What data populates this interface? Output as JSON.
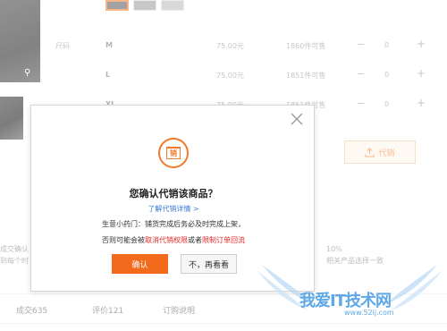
{
  "background": {
    "sizes": [
      {
        "label": "尺码",
        "size": "M",
        "price": "75.00元",
        "stock": "1860件可售",
        "qty": "0"
      },
      {
        "label": "",
        "size": "L",
        "price": "75.00元",
        "stock": "1851件可售",
        "qty": "0"
      },
      {
        "label": "",
        "size": "XL",
        "price": "75.00元",
        "stock": "1851件可售",
        "qty": "0"
      }
    ],
    "minus": "−",
    "plus": "+",
    "consign_button": "代销",
    "info_left": [
      "成交确认",
      "到每个时"
    ],
    "info_right_top": "10%",
    "info_right_bottom": "相关产品选择一致",
    "stats": [
      "成交635",
      "评价121",
      "订购说明"
    ]
  },
  "dialog": {
    "badge_char": "销",
    "title": "您确认代销该商品？",
    "detail_link": "了解代销详情 >",
    "tip_line1": "生意小药门：铺货完成后务必及时完成上架，",
    "tip_line2_prefix": "否则可能会被",
    "tip_line2_red1": "取消代销权限",
    "tip_line2_mid": "或者",
    "tip_line2_red2": "限制订单回流",
    "confirm_button": "确认",
    "cancel_button": "不，再看看"
  },
  "watermark": {
    "text": "我爱IT技术网",
    "url": "www.52ij.com"
  },
  "colors": {
    "accent": "#f26b1d",
    "link": "#3a7bd5",
    "warning_red": "#e02a2a"
  }
}
